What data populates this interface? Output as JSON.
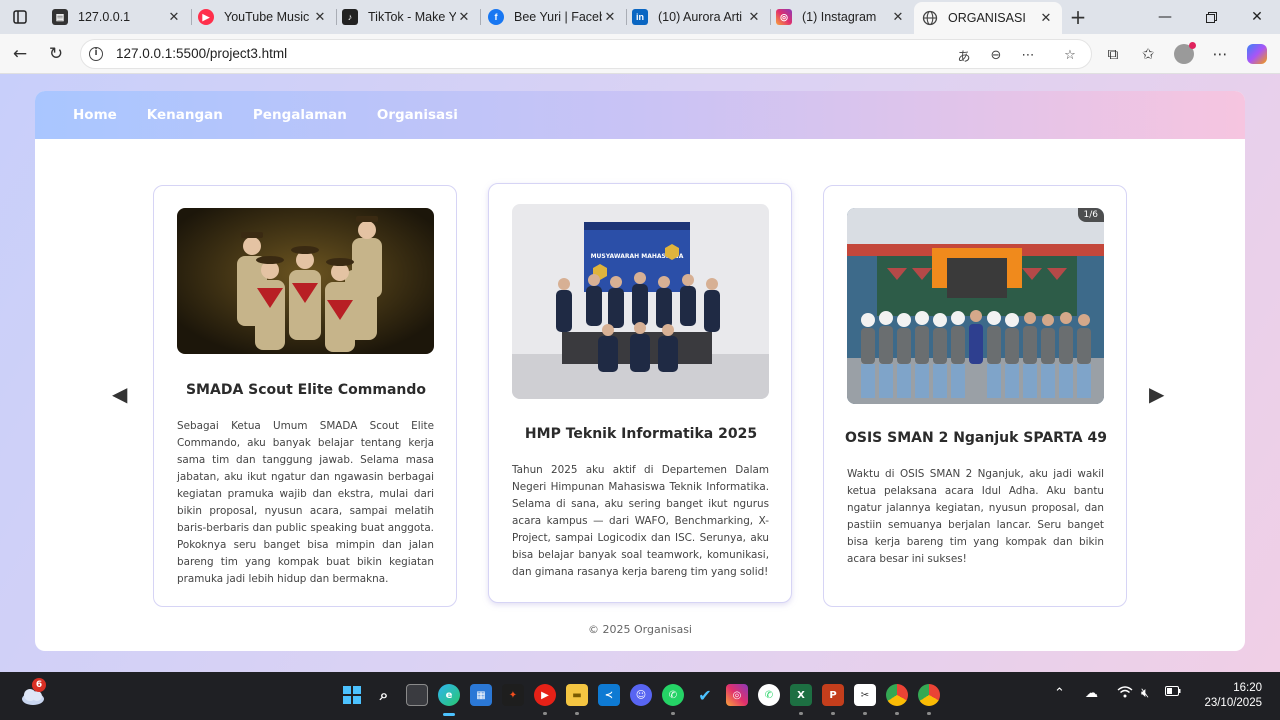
{
  "browser": {
    "tabs": [
      {
        "title": "127.0.0.1",
        "icon": "page-icon",
        "color": "#333333"
      },
      {
        "title": "YouTube Music",
        "icon": "youtube-music-icon",
        "color": "#ff2f4b"
      },
      {
        "title": "TikTok - Make Y",
        "icon": "tiktok-icon",
        "color": "#222222"
      },
      {
        "title": "Bee Yuri | Faceb",
        "icon": "facebook-icon",
        "color": "#1877f2"
      },
      {
        "title": "(10) Aurora Arti",
        "icon": "linkedin-icon",
        "color": "#0a66c2"
      },
      {
        "title": "(1) Instagram",
        "icon": "instagram-icon",
        "color": "#e1306c"
      },
      {
        "title": "ORGANISASI",
        "icon": "globe-icon",
        "color": "#444444",
        "active": true
      }
    ],
    "url": "127.0.0.1:5500/project3.html"
  },
  "site": {
    "nav": [
      "Home",
      "Kenangan",
      "Pengalaman",
      "Organisasi"
    ],
    "cards": [
      {
        "title": "SMADA Scout Elite Commando",
        "text": "Sebagai Ketua Umum SMADA Scout Elite Commando, aku banyak belajar tentang kerja sama tim dan tanggung jawab. Selama masa jabatan, aku ikut ngatur dan ngawasin berbagai kegiatan pramuka wajib dan ekstra, mulai dari bikin proposal, nyusun acara, sampai melatih baris-berbaris dan public speaking buat anggota. Pokoknya seru banget bisa mimpin dan jalan bareng tim yang kompak buat bikin kegiatan pramuka jadi lebih hidup dan bermakna."
      },
      {
        "title": "HMP Teknik Informatika 2025",
        "text": "Tahun 2025 aku aktif di Departemen Dalam Negeri Himpunan Mahasiswa Teknik Informatika. Selama di sana, aku sering banget ikut ngurus acara kampus — dari WAFO, Benchmarking, X-Project, sampai Logicodix dan ISC. Serunya, aku bisa belajar banyak soal teamwork, komunikasi, dan gimana rasanya kerja bareng tim yang solid!",
        "banner": "MUSYAWARAH MAHASISWA"
      },
      {
        "title": "OSIS SMAN 2 Nganjuk SPARTA 49",
        "text": "Waktu di OSIS SMAN 2 Nganjuk, aku jadi wakil ketua pelaksana acara Idul Adha. Aku bantu ngatur jalannya kegiatan, nyusun proposal, dan pastiin semuanya berjalan lancar. Seru banget bisa kerja bareng tim yang kompak dan bikin acara besar ini sukses!",
        "badge": "1/6"
      }
    ],
    "footer": "© 2025 Organisasi"
  },
  "taskbar": {
    "notification_count": "6",
    "time": "16:20",
    "date": "23/10/2025"
  }
}
